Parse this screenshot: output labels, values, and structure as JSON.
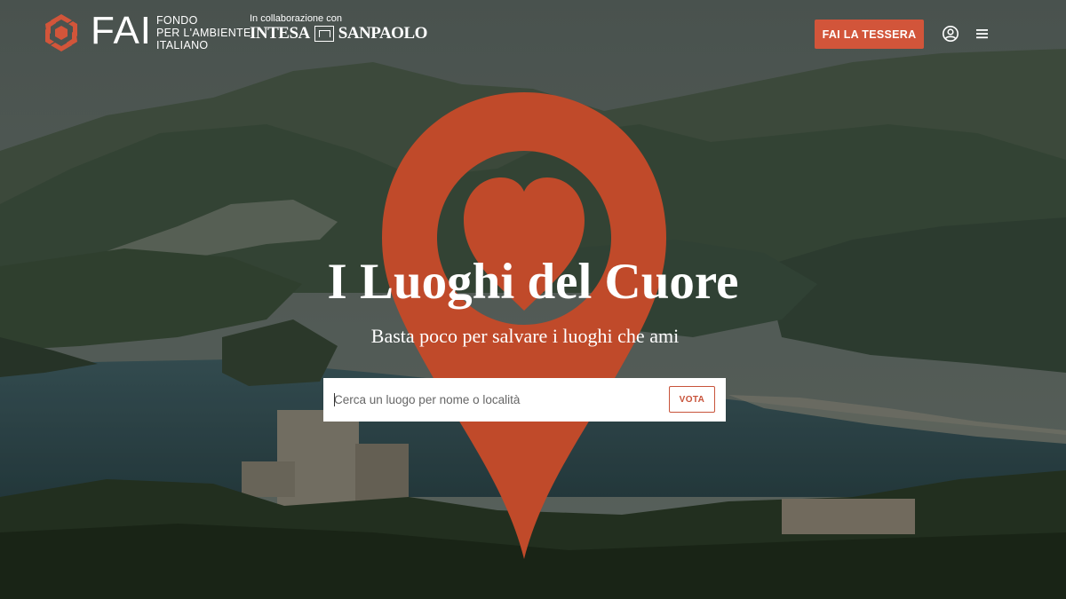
{
  "brand": {
    "name": "FAI",
    "subtitle_lines": [
      "FONDO",
      "PER L'AMBIENTE",
      "ITALIANO"
    ],
    "collab_label": "In collaborazione con",
    "partner_left": "INTESA",
    "partner_right": "SANPAOLO",
    "accent_color": "#d2553a"
  },
  "header": {
    "cta_label": "FAI LA TESSERA",
    "icons": [
      "user-icon",
      "menu-icon"
    ]
  },
  "hero": {
    "title": "I Luoghi del Cuore",
    "subtitle": "Basta poco per salvare i luoghi che ami",
    "pin_icon": "map-pin-heart-icon"
  },
  "search": {
    "placeholder": "Cerca un luogo per nome o località",
    "value": "",
    "button_label": "VOTA"
  }
}
